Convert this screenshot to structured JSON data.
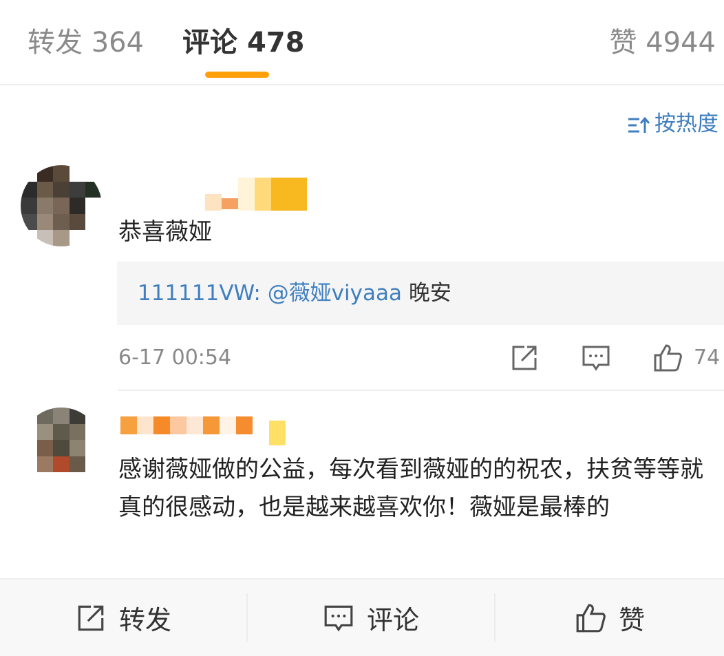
{
  "tabs": {
    "repost_label": "转发",
    "repost_count": "364",
    "comment_label": "评论",
    "comment_count": "478",
    "like_label": "赞",
    "like_count": "4944"
  },
  "sort": {
    "label": "按热度",
    "icon": "sort-icon"
  },
  "comments": [
    {
      "text": "恭喜薇娅",
      "reply": {
        "user": "111111VW:",
        "mention": "@薇娅viyaaa",
        "text": "晚安"
      },
      "time": "6-17 00:54",
      "likes": "74"
    },
    {
      "text": "感谢薇娅做的公益，每次看到薇娅的的祝农，扶贫等等就真的很感动，也是越来越喜欢你！薇娅是最棒的"
    }
  ],
  "bottom_bar": {
    "repost_label": "转发",
    "comment_label": "评论",
    "like_label": "赞"
  },
  "colors": {
    "accent": "#ff9f0a",
    "link": "#3f7fbf",
    "muted": "#888888"
  }
}
